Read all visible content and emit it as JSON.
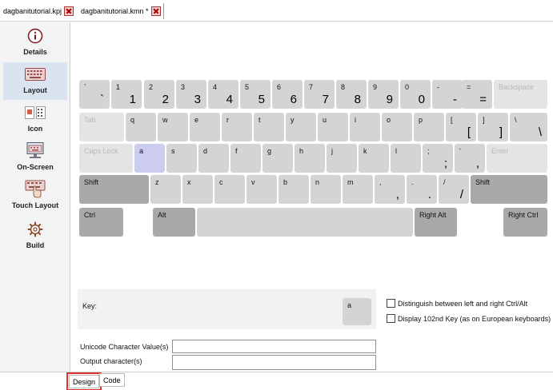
{
  "tabs": [
    {
      "label": "dagbanitutorial.kpj"
    },
    {
      "label": "dagbanitutorial.kmn *"
    }
  ],
  "sidebar": {
    "items": [
      {
        "label": "Details",
        "icon": "info-icon"
      },
      {
        "label": "Layout",
        "icon": "keyboard-layout-icon"
      },
      {
        "label": "Icon",
        "icon": "icon-editor-icon"
      },
      {
        "label": "On-Screen",
        "icon": "on-screen-keyboard-icon"
      },
      {
        "label": "Touch Layout",
        "icon": "touch-layout-icon"
      },
      {
        "label": "Build",
        "icon": "gear-icon"
      }
    ]
  },
  "keyboard": {
    "rows": [
      [
        {
          "base": "`",
          "shift": "`"
        },
        {
          "base": "1",
          "shift": "1"
        },
        {
          "base": "2",
          "shift": "2"
        },
        {
          "base": "3",
          "shift": "3"
        },
        {
          "base": "4",
          "shift": "4"
        },
        {
          "base": "5",
          "shift": "5"
        },
        {
          "base": "6",
          "shift": "6"
        },
        {
          "base": "7",
          "shift": "7"
        },
        {
          "base": "8",
          "shift": "8"
        },
        {
          "base": "9",
          "shift": "9"
        },
        {
          "base": "0",
          "shift": "0"
        },
        {
          "base": "-",
          "shift": "-"
        },
        {
          "base": "=",
          "shift": "="
        },
        {
          "base": "Backspace",
          "shift": ""
        }
      ],
      [
        {
          "base": "Tab",
          "shift": ""
        },
        {
          "base": "q",
          "shift": ""
        },
        {
          "base": "w",
          "shift": ""
        },
        {
          "base": "e",
          "shift": ""
        },
        {
          "base": "r",
          "shift": ""
        },
        {
          "base": "t",
          "shift": ""
        },
        {
          "base": "y",
          "shift": ""
        },
        {
          "base": "u",
          "shift": ""
        },
        {
          "base": "i",
          "shift": ""
        },
        {
          "base": "o",
          "shift": ""
        },
        {
          "base": "p",
          "shift": ""
        },
        {
          "base": "[",
          "shift": "["
        },
        {
          "base": "]",
          "shift": "]"
        },
        {
          "base": "\\",
          "shift": "\\"
        }
      ],
      [
        {
          "base": "Caps Lock",
          "shift": ""
        },
        {
          "base": "a",
          "shift": ""
        },
        {
          "base": "s",
          "shift": ""
        },
        {
          "base": "d",
          "shift": ""
        },
        {
          "base": "f",
          "shift": ""
        },
        {
          "base": "g",
          "shift": ""
        },
        {
          "base": "h",
          "shift": ""
        },
        {
          "base": "j",
          "shift": ""
        },
        {
          "base": "k",
          "shift": ""
        },
        {
          "base": "l",
          "shift": ""
        },
        {
          "base": ";",
          "shift": ";"
        },
        {
          "base": "'",
          "shift": ","
        },
        {
          "base": "Enter",
          "shift": ""
        }
      ],
      [
        {
          "base": "Shift",
          "shift": ""
        },
        {
          "base": "z",
          "shift": ""
        },
        {
          "base": "x",
          "shift": ""
        },
        {
          "base": "c",
          "shift": ""
        },
        {
          "base": "v",
          "shift": ""
        },
        {
          "base": "b",
          "shift": ""
        },
        {
          "base": "n",
          "shift": ""
        },
        {
          "base": "m",
          "shift": ""
        },
        {
          "base": ",",
          "shift": ","
        },
        {
          "base": ".",
          "shift": "."
        },
        {
          "base": "/",
          "shift": "/"
        },
        {
          "base": "Shift",
          "shift": ""
        }
      ],
      [
        {
          "base": "Ctrl",
          "shift": ""
        },
        {
          "base": "Alt",
          "shift": ""
        },
        {
          "base": "",
          "shift": ""
        },
        {
          "base": "Right Alt",
          "shift": ""
        },
        {
          "base": "Right Ctrl",
          "shift": ""
        }
      ]
    ],
    "selected_key": "a"
  },
  "keypanel": {
    "key_label": "Key:",
    "key_value": "a",
    "unicode_label": "Unicode Character Value(s)",
    "unicode_value": "",
    "output_label": "Output character(s)",
    "output_value": ""
  },
  "options": [
    {
      "label": "Distinguish between left and right Ctrl/Alt",
      "checked": false
    },
    {
      "label": "Display 102nd Key (as on European keyboards)",
      "checked": false
    }
  ],
  "bottom_tabs": [
    {
      "label": "Design"
    },
    {
      "label": "Code"
    }
  ],
  "colors": {
    "key": "#d4d4d4",
    "modifier_key": "#a9a9a9",
    "disabled_key": "#e4e4e4",
    "selected_key": "#ccccf0",
    "highlight_outline": "#e03030"
  }
}
